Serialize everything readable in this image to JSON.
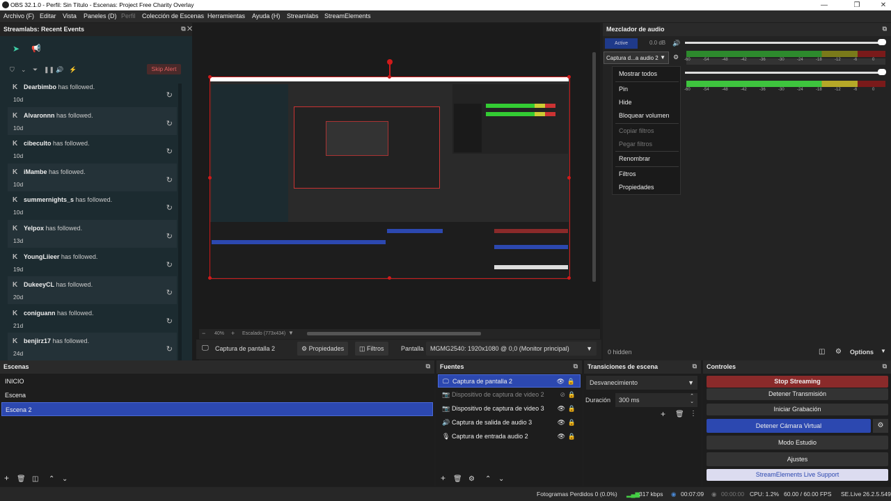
{
  "window": {
    "title": "OBS 32.1.0 - Perfil: Sin Título - Escenas: Project Free Charity Overlay",
    "minimize": "—",
    "maximize": "❐",
    "close": "✕"
  },
  "menu": [
    "Archivo (F)",
    "Editar",
    "Vista",
    "Paneles (D)",
    "Perfil",
    "Colección de Escenas",
    "Herramientas",
    "Ayuda (H)",
    "Streamlabs",
    "StreamElements"
  ],
  "recent_events": {
    "title": "Streamlabs: Recent Events",
    "skip_alert": "Skip Alert",
    "events": [
      {
        "user": "Dearbimbo",
        "action": "has followed.",
        "age": "10d"
      },
      {
        "user": "Alvaronnn",
        "action": "has followed.",
        "age": "10d"
      },
      {
        "user": "cibeculto",
        "action": "has followed.",
        "age": "10d"
      },
      {
        "user": "iMambe",
        "action": "has followed.",
        "age": "10d"
      },
      {
        "user": "summernights_s",
        "action": "has followed.",
        "age": "10d"
      },
      {
        "user": "Yelpox",
        "action": "has followed.",
        "age": "13d"
      },
      {
        "user": "YoungLiieer",
        "action": "has followed.",
        "age": "19d"
      },
      {
        "user": "DukeeyCL",
        "action": "has followed.",
        "age": "20d"
      },
      {
        "user": "coniguann",
        "action": "has followed.",
        "age": "21d"
      },
      {
        "user": "benjirz17",
        "action": "has followed.",
        "age": "24d"
      }
    ]
  },
  "preview": {
    "zoom": "40%",
    "scale_label": "Escalado (773x434)",
    "source_name": "Captura de pantalla 2",
    "properties": "Propiedades",
    "filters": "Filtros",
    "display_label": "Pantalla",
    "display_value": "MGMG2540: 1920x1080 @ 0,0 (Monitor principal)"
  },
  "mixer": {
    "title": "Mezclador de audio",
    "active": "Active",
    "db": "0.0 dB",
    "channel_label": "Captura d...a audio 2",
    "hidden": "0 hidden",
    "options": "Options",
    "scale": [
      "-60",
      "-54",
      "-48",
      "-42",
      "-36",
      "-30",
      "-24",
      "-18",
      "-12",
      "-6",
      "0"
    ],
    "context_menu": {
      "show_all": "Mostrar todos",
      "pin": "Pin",
      "hide": "Hide",
      "lock_volume": "Bloquear volumen",
      "copy_filters": "Copiar filtros",
      "paste_filters": "Pegar filtros",
      "rename": "Renombrar",
      "filters": "Filtros",
      "properties": "Propiedades"
    }
  },
  "scenes": {
    "title": "Escenas",
    "items": [
      "INICIO",
      "Escena",
      "Escena 2"
    ],
    "selected": "Escena 2"
  },
  "sources": {
    "title": "Fuentes",
    "items": [
      {
        "name": "Captura de pantalla 2",
        "icon": "monitor-icon"
      },
      {
        "name": "Dispositivo de captura de video 2",
        "icon": "camera-icon"
      },
      {
        "name": "Dispositivo de captura de video 3",
        "icon": "camera-icon"
      },
      {
        "name": "Captura de salida de audio 3",
        "icon": "speaker-icon"
      },
      {
        "name": "Captura de entrada audio 2",
        "icon": "mic-icon"
      }
    ]
  },
  "transitions": {
    "title": "Transiciones de escena",
    "type": "Desvanecimiento",
    "duration_label": "Duración",
    "duration": "300 ms"
  },
  "controls": {
    "title": "Controles",
    "stop_streaming": "Stop Streaming",
    "stop_transmission": "Detener Transmisión",
    "start_recording": "Iniciar Grabación",
    "stop_virtual_cam": "Detener Cámara Virtual",
    "studio_mode": "Modo Estudio",
    "settings": "Ajustes",
    "se_support": "StreamElements Live Support"
  },
  "status": {
    "dropped": "Fotogramas Perdidos 0 (0.0%)",
    "kbps": "317 kbps",
    "stream_time": "00:07:09",
    "rec_time": "00:00:00",
    "cpu": "CPU: 1.2%",
    "fps": "60.00 / 60.00 FPS",
    "se_version": "SE.Live 26.2.5.549"
  },
  "colors": {
    "accent": "#2c48b0",
    "stop": "#8a2a2a",
    "live": "#3a8a3a",
    "selection_border": "#d01a1a"
  }
}
